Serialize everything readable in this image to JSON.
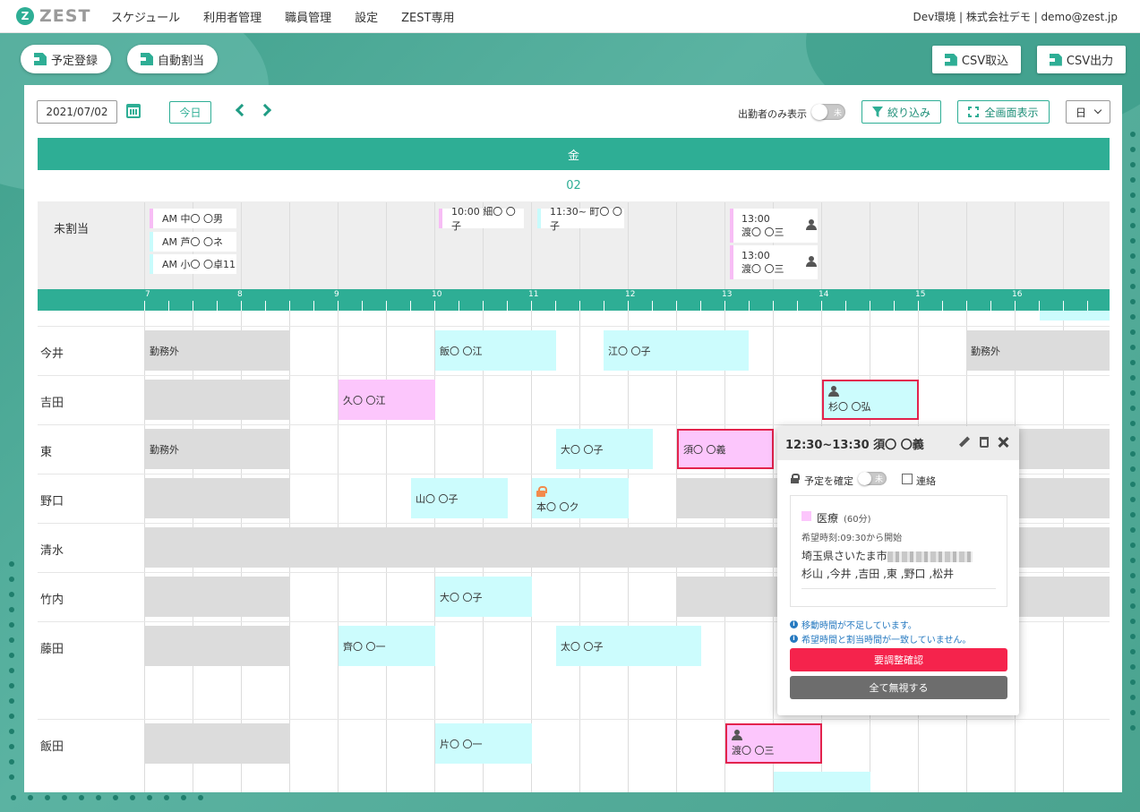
{
  "header": {
    "logo_text": "ZEST",
    "logo_mark": "Z",
    "nav": [
      "スケジュール",
      "利用者管理",
      "職員管理",
      "設定",
      "ZEST専用"
    ],
    "account": "Dev環境 | 株式会社デモ | demo@zest.jp"
  },
  "actions": {
    "register": "予定登録",
    "auto_assign": "自動割当",
    "csv_import": "CSV取込",
    "csv_export": "CSV出力"
  },
  "toolbar": {
    "date": "2021/07/02",
    "today": "今日",
    "attendance_only": "出勤者のみ表示",
    "toggle_off": "未",
    "filter": "絞り込み",
    "fullscreen": "全画面表示",
    "view": "日"
  },
  "calendar": {
    "weekday": "金",
    "day": "02",
    "unassigned_label": "未割当",
    "hours": [
      "7",
      "8",
      "9",
      "10",
      "11",
      "12",
      "13",
      "14",
      "15",
      "16"
    ],
    "unassigned": [
      {
        "text": "AM 中〇 〇男",
        "color": "#f7bdf5"
      },
      {
        "text": "AM 芦〇 〇ネ",
        "color": "#c8fbfc"
      },
      {
        "text": "AM 小〇 〇卓11",
        "color": "#c8fbfc"
      },
      {
        "text": "10:00 細〇 〇子",
        "color": "#f7bdf5"
      },
      {
        "text": "11:30~ 町〇 〇子",
        "color": "#c8fbfc"
      }
    ],
    "unassigned_tall": [
      {
        "time": "13:00",
        "name": "渡〇 〇三"
      },
      {
        "time": "13:00",
        "name": "渡〇 〇三"
      }
    ],
    "staff": [
      "今井",
      "吉田",
      "東",
      "野口",
      "清水",
      "竹内",
      "藤田",
      "飯田"
    ],
    "off_duty": "勤務外",
    "blocks": {
      "imai_1": "飯〇 〇江",
      "imai_2": "江〇 〇子",
      "yoshida_1": "久〇 〇江",
      "yoshida_2": "杉〇 〇弘",
      "higashi_1": "大〇 〇子",
      "higashi_2": "須〇 〇義",
      "noguchi_1": "山〇 〇子",
      "noguchi_2": "本〇 〇ク",
      "takeuchi_1": "大〇 〇子",
      "fujita_1": "齊〇 〇一",
      "fujita_2": "太〇 〇子",
      "iida_1": "片〇 〇一",
      "iida_2": "渡〇 〇三"
    }
  },
  "popover": {
    "title": "12:30~13:30 須〇 〇義",
    "confirm_label": "予定を確定",
    "toggle_off": "未",
    "contact_label": "連絡",
    "service": "医療",
    "duration": "(60分)",
    "desired_time": "希望時刻:09:30から開始",
    "address": "埼玉県さいたま市",
    "staff_list": "杉山 ,今井 ,吉田 ,東 ,野口 ,松井",
    "warning_1": "移動時間が不足しています。",
    "warning_2": "希望時間と割当時間が一致していません。",
    "adjust_button": "要調整確認",
    "ignore_button": "全て無視する"
  }
}
